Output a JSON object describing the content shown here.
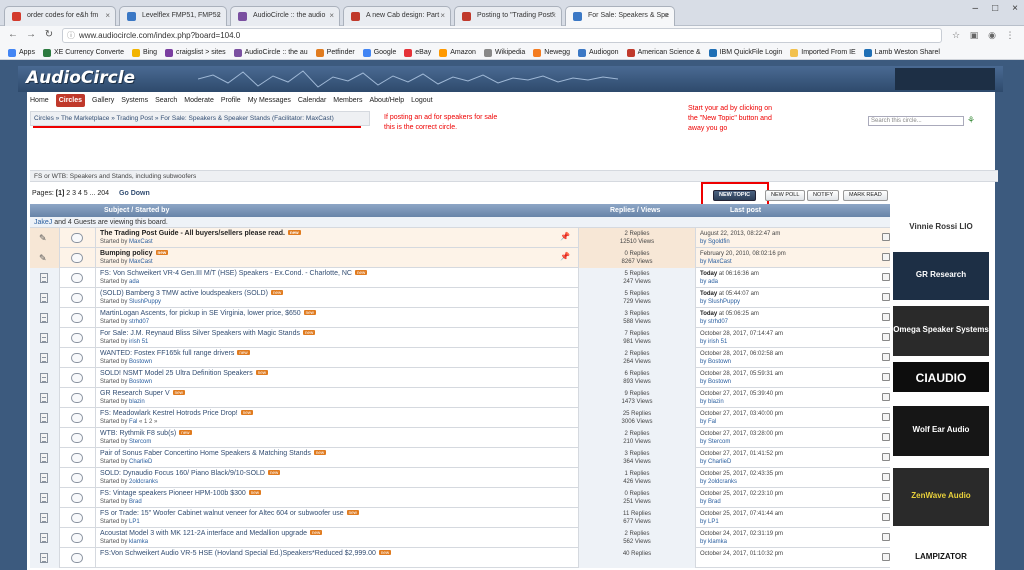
{
  "browser": {
    "tabs": [
      {
        "label": "order codes for e&h fm",
        "color": "#d33a2c"
      },
      {
        "label": "Levelflex FMP51, FMP52",
        "color": "#3b78c5"
      },
      {
        "label": "AudioCircle :: the audio",
        "color": "#7a4fa0"
      },
      {
        "label": "A new Cab design: Part",
        "color": "#c0392b"
      },
      {
        "label": "Posting to \"Trading Post\"",
        "color": "#c0392b"
      },
      {
        "label": "For Sale: Speakers & Spe",
        "color": "#3b78c5"
      }
    ],
    "url": "www.audiocircle.com/index.php?board=104.0",
    "bookmarks": [
      {
        "label": "Apps",
        "color": "#4285f4"
      },
      {
        "label": "XE Currency Converte",
        "color": "#2c7a3f"
      },
      {
        "label": "Bing",
        "color": "#f2b400"
      },
      {
        "label": "craigslist > sites",
        "color": "#7a3ea0"
      },
      {
        "label": "AudioCircle :: the au",
        "color": "#7a4fa0"
      },
      {
        "label": "Petfinder",
        "color": "#e07b1f"
      },
      {
        "label": "Google",
        "color": "#4285f4"
      },
      {
        "label": "eBay",
        "color": "#e53238"
      },
      {
        "label": "Amazon",
        "color": "#ff9900"
      },
      {
        "label": "Wikipedia",
        "color": "#888"
      },
      {
        "label": "Newegg",
        "color": "#f47c20"
      },
      {
        "label": "Audiogon",
        "color": "#3b78c5"
      },
      {
        "label": "American Science &",
        "color": "#c0392b"
      },
      {
        "label": "IBM QuickFile Login",
        "color": "#1f6fb5"
      },
      {
        "label": "Imported From IE",
        "color": "#f2c14e"
      },
      {
        "label": "Lamb Weston Sharel",
        "color": "#1f6fb5"
      }
    ]
  },
  "site": {
    "logo": "AudioCircle",
    "menu": [
      "Home",
      "Circles",
      "Gallery",
      "Systems",
      "Search",
      "Moderate",
      "Profile",
      "My Messages",
      "Calendar",
      "Members",
      "About/Help",
      "Logout"
    ],
    "active_menu": "Circles",
    "search_placeholder": "Search this circle...",
    "breadcrumb": "Circles » The Marketplace » Trading Post » For Sale: Speakers & Speaker Stands (Facilitator: MaxCast)",
    "description": "FS or WTB: Speakers and Stands, including subwoofers",
    "pages_label": "Pages:",
    "pages_current": "[1]",
    "pages_rest": "2 3 4 5 ... 204",
    "go_down": "Go Down",
    "buttons": {
      "new_topic": "NEW TOPIC",
      "new_poll": "NEW POLL",
      "notify": "NOTIFY",
      "mark_read": "MARK READ"
    }
  },
  "annotations": {
    "left": "If posting an ad for speakers for sale this is the correct circle.",
    "right": "Start your ad by clicking on the \"New Topic\" button and away you go"
  },
  "table": {
    "headers": {
      "subject": "Subject / Started by",
      "replies": "Replies / Views",
      "last_post": "Last post"
    },
    "viewing_user": "JakeJ",
    "viewing_rest": "and 4 Guests are viewing this board.",
    "started_by_prefix": "Started by",
    "new_badge": "new",
    "rows": [
      {
        "title": "The Trading Post Guide - All buyers/sellers please read.",
        "starter": "MaxCast",
        "replies": "2 Replies",
        "views": "12510 Views",
        "date": "August 22, 2013, 08:22:47 am",
        "by": "by Sgoldfin",
        "sticky": true,
        "new": true
      },
      {
        "title": "Bumping policy",
        "starter": "MaxCast",
        "replies": "0 Replies",
        "views": "8267 Views",
        "date": "February 20, 2010, 08:02:16 pm",
        "by": "by MaxCast",
        "sticky": true,
        "new": true
      },
      {
        "title": "FS: Von Schweikert VR-4 Gen.III M/T (HSE) Speakers - Ex.Cond. - Charlotte, NC",
        "starter": "ada",
        "replies": "5 Replies",
        "views": "247 Views",
        "date_bold": "Today",
        "date": "at 06:16:36 am",
        "by": "by ada",
        "new": true
      },
      {
        "title": "(SOLD) Bamberg 3 TMW active loudspeakers (SOLD)",
        "starter": "SlushPuppy",
        "replies": "5 Replies",
        "views": "729 Views",
        "date_bold": "Today",
        "date": "at 05:44:07 am",
        "by": "by SlushPuppy",
        "new": true
      },
      {
        "title": "MartinLogan Ascents, for pickup in SE Virginia, lower price, $650",
        "starter": "strhd07",
        "replies": "3 Replies",
        "views": "588 Views",
        "date_bold": "Today",
        "date": "at 05:06:25 am",
        "by": "by strhd07",
        "new": true
      },
      {
        "title": "For Sale: J.M. Reynaud Bliss Silver Speakers with Magic Stands",
        "starter": "irish 51",
        "replies": "7 Replies",
        "views": "981 Views",
        "date": "October 28, 2017, 07:14:47 am",
        "by": "by irish 51",
        "new": true
      },
      {
        "title": "WANTED: Fostex FF165k full range drivers",
        "starter": "Bostown",
        "replies": "2 Replies",
        "views": "264 Views",
        "date": "October 28, 2017, 06:02:58 am",
        "by": "by Bostown",
        "new": true
      },
      {
        "title": "SOLD! NSMT Model 25 Ultra Definition Speakers",
        "starter": "Bostown",
        "replies": "6 Replies",
        "views": "893 Views",
        "date": "October 28, 2017, 05:59:31 am",
        "by": "by Bostown",
        "new": true
      },
      {
        "title": "GR Research Super V",
        "starter": "blazin",
        "replies": "9 Replies",
        "views": "1473 Views",
        "date": "October 27, 2017, 05:39:40 pm",
        "by": "by blazin",
        "new": true
      },
      {
        "title": "FS: Meadowlark Kestrel Hotrods Price Drop!",
        "starter": "Fal",
        "pages": "« 1 2 »",
        "replies": "25 Replies",
        "views": "3006 Views",
        "date": "October 27, 2017, 03:40:00 pm",
        "by": "by Fal",
        "new": true
      },
      {
        "title": "WTB: Rythmik F8 sub(s)",
        "starter": "Stercom",
        "replies": "2 Replies",
        "views": "210 Views",
        "date": "October 27, 2017, 03:28:00 pm",
        "by": "by Stercom",
        "new": true
      },
      {
        "title": "Pair of Sonus Faber Concertino Home Speakers & Matching Stands",
        "starter": "CharlieD",
        "replies": "3 Replies",
        "views": "364 Views",
        "date": "October 27, 2017, 01:41:52 pm",
        "by": "by CharlieD",
        "new": true
      },
      {
        "title": "SOLD: Dynaudio Focus 160/ Piano Black/9/10-SOLD",
        "starter": "2oldcranks",
        "replies": "1 Replies",
        "views": "426 Views",
        "date": "October 25, 2017, 02:43:35 pm",
        "by": "by 2oldcranks",
        "new": true
      },
      {
        "title": "FS: Vintage speakers Pioneer HPM-100b $300",
        "starter": "Brad",
        "replies": "0 Replies",
        "views": "251 Views",
        "date": "October 25, 2017, 02:23:10 pm",
        "by": "by Brad",
        "new": true
      },
      {
        "title": "FS or Trade: 15\" Woofer Cabinet walnut veneer for Altec 604 or subwoofer use",
        "starter": "LP1",
        "replies": "11 Replies",
        "views": "677 Views",
        "date": "October 25, 2017, 07:41:44 am",
        "by": "by LP1",
        "new": true
      },
      {
        "title": "Acoustat Model 3 with MK 121-2A interface and Medallion upgrade",
        "starter": "klamka",
        "replies": "2 Replies",
        "views": "562 Views",
        "date": "October 24, 2017, 02:31:19 pm",
        "by": "by klamka",
        "new": true
      },
      {
        "title": "FS:Von Schweikert Audio VR-5 HSE (Hovland Special Ed.)Speakers*Reduced $2,999.00",
        "starter": "",
        "replies": "40 Replies",
        "views": "",
        "date": "October 24, 2017, 01:10:32 pm",
        "by": "",
        "new": true
      }
    ]
  },
  "ads": [
    {
      "label": "Vinnie Rossi LIO",
      "bg": "#ffffff",
      "fg": "#333333"
    },
    {
      "label": "GR Research",
      "bg": "#1d2f45",
      "fg": "#ffffff"
    },
    {
      "label": "Omega Speaker Systems",
      "bg": "#2a2a2a",
      "fg": "#ffffff"
    },
    {
      "label": "CIAUDIO",
      "bg": "#0d0d0d",
      "fg": "#ffffff"
    },
    {
      "label": "Wolf Ear Audio",
      "bg": "#161616",
      "fg": "#ffffff"
    },
    {
      "label": "ZenWave Audio",
      "bg": "#2a2a2a",
      "fg": "#e8d03b"
    },
    {
      "label": "LAMPIZATOR",
      "bg": "#ffffff",
      "fg": "#111111"
    }
  ]
}
